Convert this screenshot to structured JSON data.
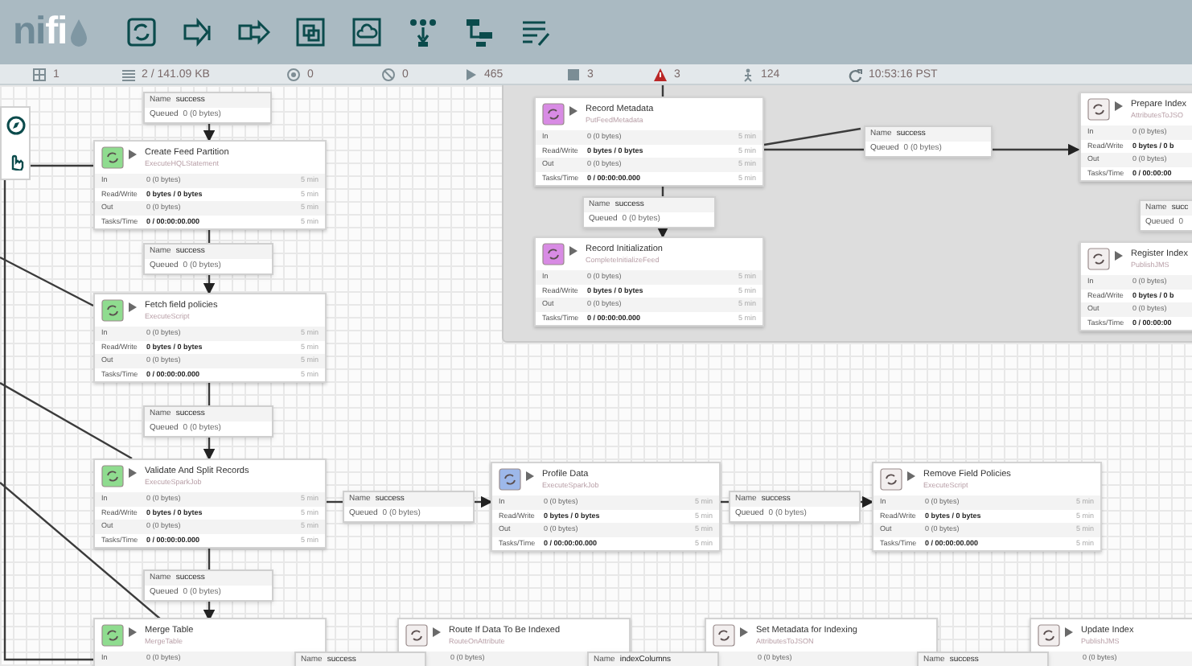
{
  "header": {
    "logo": {
      "prefix": "ni",
      "suffix": "fi"
    }
  },
  "status_bar": [
    {
      "kind": "nodes",
      "text": "1"
    },
    {
      "kind": "queued",
      "text": "2 / 141.09 KB"
    },
    {
      "kind": "transmitting",
      "text": "0"
    },
    {
      "kind": "not_transmitting",
      "text": "0"
    },
    {
      "kind": "running",
      "text": "465"
    },
    {
      "kind": "stopped",
      "text": "3"
    },
    {
      "kind": "invalid",
      "text": "3"
    },
    {
      "kind": "disabled",
      "text": "124"
    },
    {
      "kind": "refresh",
      "text": "10:53:16 PST"
    }
  ],
  "processors": [
    {
      "name": "Create Feed Partition",
      "type": "ExecuteHQLStatement",
      "color": "#8fdc8f",
      "stats": [
        {
          "label": "In",
          "value": "0 (0 bytes)",
          "period": "5 min"
        },
        {
          "label": "Read/Write",
          "value": "0 bytes / 0 bytes",
          "period": "5 min"
        },
        {
          "label": "Out",
          "value": "0 (0 bytes)",
          "period": "5 min"
        },
        {
          "label": "Tasks/Time",
          "value": "0 / 00:00:00.000",
          "period": "5 min"
        }
      ]
    },
    {
      "name": "Fetch field policies",
      "type": "ExecuteScript",
      "color": "#8fdc8f",
      "stats": [
        {
          "label": "In",
          "value": "0 (0 bytes)",
          "period": "5 min"
        },
        {
          "label": "Read/Write",
          "value": "0 bytes / 0 bytes",
          "period": "5 min"
        },
        {
          "label": "Out",
          "value": "0 (0 bytes)",
          "period": "5 min"
        },
        {
          "label": "Tasks/Time",
          "value": "0 / 00:00:00.000",
          "period": "5 min"
        }
      ]
    },
    {
      "name": "Validate And Split Records",
      "type": "ExecuteSparkJob",
      "color": "#8fdc8f",
      "stats": [
        {
          "label": "In",
          "value": "0 (0 bytes)",
          "period": "5 min"
        },
        {
          "label": "Read/Write",
          "value": "0 bytes / 0 bytes",
          "period": "5 min"
        },
        {
          "label": "Out",
          "value": "0 (0 bytes)",
          "period": "5 min"
        },
        {
          "label": "Tasks/Time",
          "value": "0 / 00:00:00.000",
          "period": "5 min"
        }
      ]
    },
    {
      "name": "Merge Table",
      "type": "MergeTable",
      "color": "#8fdc8f",
      "stats": [
        {
          "label": "In",
          "value": "0 (0 bytes)"
        }
      ]
    },
    {
      "name": "Record Metadata",
      "type": "PutFeedMetadata",
      "color": "#d88be4",
      "stats": [
        {
          "label": "In",
          "value": "0 (0 bytes)",
          "period": "5 min"
        },
        {
          "label": "Read/Write",
          "value": "0 bytes / 0 bytes",
          "period": "5 min"
        },
        {
          "label": "Out",
          "value": "0 (0 bytes)",
          "period": "5 min"
        },
        {
          "label": "Tasks/Time",
          "value": "0 / 00:00:00.000",
          "period": "5 min"
        }
      ]
    },
    {
      "name": "Record Initialization",
      "type": "CompleteInitializeFeed",
      "color": "#d88be4",
      "stats": [
        {
          "label": "In",
          "value": "0 (0 bytes)",
          "period": "5 min"
        },
        {
          "label": "Read/Write",
          "value": "0 bytes / 0 bytes",
          "period": "5 min"
        },
        {
          "label": "Out",
          "value": "0 (0 bytes)",
          "period": "5 min"
        },
        {
          "label": "Tasks/Time",
          "value": "0 / 00:00:00.000",
          "period": "5 min"
        }
      ]
    },
    {
      "name": "Prepare Index",
      "type": "AttributesToJSO",
      "color": "#f2eeee",
      "stats": [
        {
          "label": "In",
          "value": "0 (0 bytes)"
        },
        {
          "label": "Read/Write",
          "value": "0 bytes / 0 b"
        },
        {
          "label": "Out",
          "value": "0 (0 bytes)"
        },
        {
          "label": "Tasks/Time",
          "value": "0 / 00:00:00"
        }
      ]
    },
    {
      "name": "Register Index",
      "type": "PublishJMS",
      "color": "#f2eeee",
      "stats": [
        {
          "label": "In",
          "value": "0 (0 bytes)"
        },
        {
          "label": "Read/Write",
          "value": "0 bytes / 0 b"
        },
        {
          "label": "Out",
          "value": "0 (0 bytes)"
        },
        {
          "label": "Tasks/Time",
          "value": "0 / 00:00:00"
        }
      ]
    },
    {
      "name": "Profile Data",
      "type": "ExecuteSparkJob",
      "color": "#9db8ea",
      "stats": [
        {
          "label": "In",
          "value": "0 (0 bytes)",
          "period": "5 min"
        },
        {
          "label": "Read/Write",
          "value": "0 bytes / 0 bytes",
          "period": "5 min"
        },
        {
          "label": "Out",
          "value": "0 (0 bytes)",
          "period": "5 min"
        },
        {
          "label": "Tasks/Time",
          "value": "0 / 00:00:00.000",
          "period": "5 min"
        }
      ]
    },
    {
      "name": "Remove Field Policies",
      "type": "ExecuteScript",
      "color": "#f2eeee",
      "stats": [
        {
          "label": "In",
          "value": "0 (0 bytes)",
          "period": "5 min"
        },
        {
          "label": "Read/Write",
          "value": "0 bytes / 0 bytes",
          "period": "5 min"
        },
        {
          "label": "Out",
          "value": "0 (0 bytes)",
          "period": "5 min"
        },
        {
          "label": "Tasks/Time",
          "value": "0 / 00:00:00.000",
          "period": "5 min"
        }
      ]
    },
    {
      "name": "Route If Data To Be Indexed",
      "type": "RouteOnAttribute",
      "color": "#f2eeee",
      "stats": [
        {
          "value": "0 (0 bytes)"
        }
      ]
    },
    {
      "name": "Set Metadata for Indexing",
      "type": "AttributesToJSON",
      "color": "#f2eeee",
      "stats": [
        {
          "value": "0 (0 bytes)"
        }
      ]
    },
    {
      "name": "Update Index",
      "type": "PublishJMS",
      "color": "#f2eeee",
      "stats": [
        {
          "value": "0 (0 bytes)"
        }
      ]
    }
  ],
  "connections": [
    {
      "name_label": "Name",
      "name": "success",
      "queued_label": "Queued",
      "queued": "0 (0 bytes)"
    },
    {
      "name_label": "Name",
      "name": "success",
      "queued_label": "Queued",
      "queued": "0 (0 bytes)"
    },
    {
      "name_label": "Name",
      "name": "success",
      "queued_label": "Queued",
      "queued": "0 (0 bytes)"
    },
    {
      "name_label": "Name",
      "name": "success",
      "queued_label": "Queued",
      "queued": "0 (0 bytes)"
    },
    {
      "name_label": "Name",
      "name": "success",
      "queued_label": "Queued",
      "queued": "0 (0 bytes)"
    },
    {
      "name_label": "Name",
      "name": "success",
      "queued_label": "Queued",
      "queued": "0 (0 bytes)"
    },
    {
      "name_label": "Name",
      "name": "succ",
      "queued_label": "Queued",
      "queued": "0"
    },
    {
      "name_label": "Name",
      "name": "success",
      "queued_label": "Queued",
      "queued": "0 (0 bytes)"
    },
    {
      "name_label": "Name",
      "name": "success",
      "queued_label": "Queued",
      "queued": "0 (0 bytes)"
    },
    {
      "name_label": "Name",
      "name": "success"
    },
    {
      "name_label": "Name",
      "name": "indexColumns"
    },
    {
      "name_label": "Name",
      "name": "success"
    }
  ]
}
